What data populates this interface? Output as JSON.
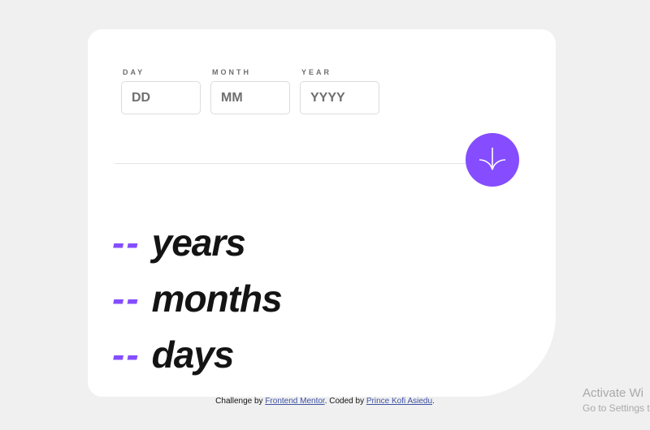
{
  "form": {
    "day": {
      "label": "DAY",
      "placeholder": "DD"
    },
    "month": {
      "label": "MONTH",
      "placeholder": "MM"
    },
    "year": {
      "label": "YEAR",
      "placeholder": "YYYY"
    }
  },
  "submit": {
    "icon": "arrow-down-icon"
  },
  "results": {
    "years": {
      "value": "--",
      "unit": "years"
    },
    "months": {
      "value": "--",
      "unit": "months"
    },
    "days": {
      "value": "--",
      "unit": "days"
    }
  },
  "footer": {
    "prefix": "Challenge by ",
    "link1": "Frontend Mentor",
    "middle": ". Coded by ",
    "link2": "Prince Kofi Asiedu",
    "suffix": "."
  },
  "watermark": {
    "title": "Activate Wi",
    "subtitle": "Go to Settings t"
  },
  "colors": {
    "accent": "#854dff",
    "background": "#f0f0f0",
    "card": "#ffffff",
    "text": "#141414"
  }
}
